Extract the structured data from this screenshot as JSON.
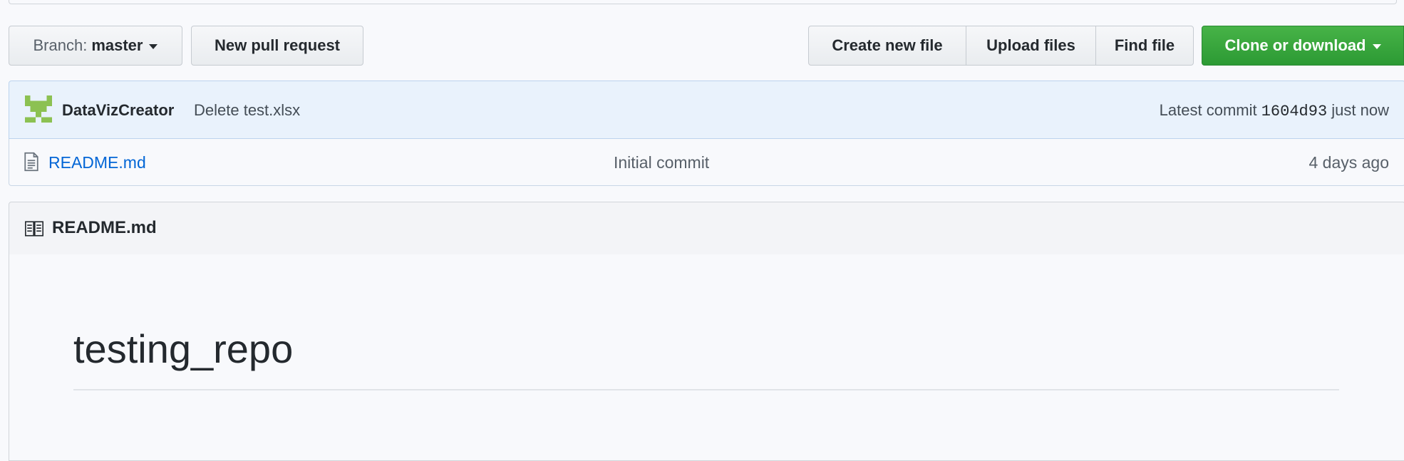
{
  "toolbar": {
    "branch_label": "Branch:",
    "branch_value": "master",
    "new_pull_request": "New pull request",
    "create_new_file": "Create new file",
    "upload_files": "Upload files",
    "find_file": "Find file",
    "clone_or_download": "Clone or download"
  },
  "commit": {
    "user": "DataVizCreator",
    "message": "Delete test.xlsx",
    "latest_label": "Latest commit",
    "sha": "1604d93",
    "time": "just now"
  },
  "files": [
    {
      "name": "README.md",
      "message": "Initial commit",
      "age": "4 days ago"
    }
  ],
  "readme": {
    "header_title": "README.md",
    "heading": "testing_repo"
  },
  "icons": {
    "avatar": "identicon-avatar",
    "file": "file-text-icon",
    "book": "book-icon",
    "caret": "caret-down-icon"
  },
  "colors": {
    "link": "#0366d6",
    "clone_green": "#2c9a34",
    "commit_bar_bg": "#e9f2fc"
  }
}
